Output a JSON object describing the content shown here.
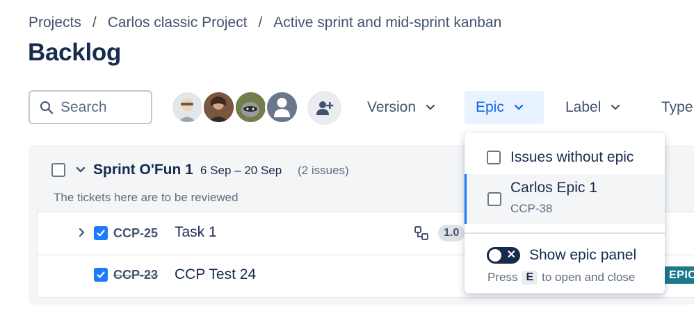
{
  "breadcrumb": {
    "items": [
      "Projects",
      "Carlos classic Project",
      "Active sprint and mid-sprint kanban"
    ],
    "separator": "/"
  },
  "page": {
    "title": "Backlog"
  },
  "search": {
    "placeholder": "Search"
  },
  "avatars": [
    "avatar-1",
    "avatar-2",
    "avatar-3",
    "avatar-default"
  ],
  "filters": {
    "version": "Version",
    "epic": "Epic",
    "label": "Label",
    "type": "Type"
  },
  "sprint": {
    "name": "Sprint O'Fun 1",
    "dates": "6 Sep – 20 Sep",
    "count": "(2 issues)",
    "goal": "The tickets here are to be reviewed"
  },
  "issues": [
    {
      "key": "CCP-25",
      "summary": "Task 1",
      "estimate": "1.0",
      "done": false
    },
    {
      "key": "CCP-23",
      "summary": "CCP Test 24",
      "done": true
    }
  ],
  "epic_lozenge": "EPIC",
  "epic_dropdown": {
    "items": [
      {
        "label": "Issues without epic"
      },
      {
        "label": "Carlos Epic 1",
        "sub": "CCP-38"
      }
    ],
    "toggle_label": "Show epic panel",
    "hint_before": "Press",
    "hint_key": "E",
    "hint_after": "to open and close"
  },
  "colors": {
    "accent": "#0c66e4",
    "checkbox": "#1d7afc",
    "epic_lozenge": "#1d7a8c",
    "text": "#172b4d"
  }
}
